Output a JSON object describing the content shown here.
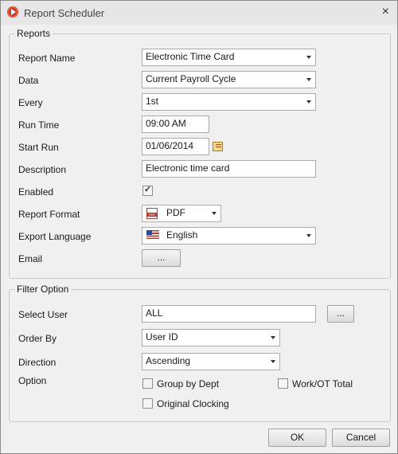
{
  "window": {
    "title": "Report Scheduler",
    "close_glyph": "×"
  },
  "reports": {
    "legend": "Reports",
    "report_name": {
      "label": "Report Name",
      "value": "Electronic Time Card"
    },
    "data": {
      "label": "Data",
      "value": "Current Payroll Cycle"
    },
    "every": {
      "label": "Every",
      "value": "1st"
    },
    "run_time": {
      "label": "Run Time",
      "value": "09:00 AM"
    },
    "start_run": {
      "label": "Start Run",
      "value": "01/06/2014",
      "icon": "calendar-icon"
    },
    "description": {
      "label": "Description",
      "value": "Electronic time card"
    },
    "enabled": {
      "label": "Enabled",
      "checked": true
    },
    "report_format": {
      "label": "Report Format",
      "value": "PDF",
      "icon": "pdf-icon"
    },
    "export_language": {
      "label": "Export Language",
      "value": "English",
      "icon": "us-flag-icon"
    },
    "email": {
      "label": "Email",
      "button": "..."
    }
  },
  "filter": {
    "legend": "Filter Option",
    "select_user": {
      "label": "Select User",
      "value": "ALL",
      "button": "..."
    },
    "order_by": {
      "label": "Order By",
      "value": "User ID"
    },
    "direction": {
      "label": "Direction",
      "value": "Ascending"
    },
    "option": {
      "label": "Option",
      "group_by_dept": {
        "label": "Group by Dept",
        "checked": false
      },
      "work_ot_total": {
        "label": "Work/OT Total",
        "checked": false
      },
      "original_clocking": {
        "label": "Original Clocking",
        "checked": false
      }
    }
  },
  "buttons": {
    "ok": "OK",
    "cancel": "Cancel"
  },
  "colors": {
    "window_bg": "#f0f0f0",
    "titlebar_bg": "#e6e6e6",
    "app_icon": "#c0392b"
  }
}
